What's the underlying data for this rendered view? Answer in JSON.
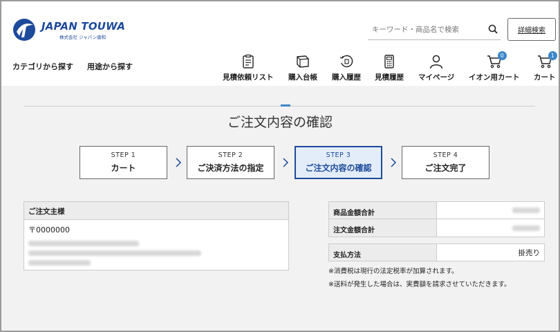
{
  "brand": {
    "name_en": "JAPAN TOUWA",
    "name_jp": "株式会社 ジャパン唐和"
  },
  "search": {
    "placeholder": "キーワード・商品名で検索",
    "advanced_label": "詳細検索"
  },
  "category_links": [
    "カテゴリから探す",
    "用途から探す"
  ],
  "nav": [
    {
      "label": "見積依頼リスト",
      "icon": "clipboard-icon"
    },
    {
      "label": "購入台帳",
      "icon": "ledger-book-icon"
    },
    {
      "label": "購入履歴",
      "icon": "history-icon"
    },
    {
      "label": "見積履歴",
      "icon": "calculator-icon"
    },
    {
      "label": "マイページ",
      "icon": "user-icon"
    },
    {
      "label": "イオン用カート",
      "icon": "cart-icon",
      "badge": "0"
    },
    {
      "label": "カート",
      "icon": "cart-icon",
      "badge": "1"
    }
  ],
  "page_title": "ご注文内容の確認",
  "steps": [
    {
      "num": "STEP 1",
      "name": "カート",
      "active": false
    },
    {
      "num": "STEP 2",
      "name": "ご決済方法の指定",
      "active": false
    },
    {
      "num": "STEP 3",
      "name": "ご注文内容の確認",
      "active": true
    },
    {
      "num": "STEP 4",
      "name": "ご注文完了",
      "active": false
    }
  ],
  "buyer": {
    "heading": "ご注文主様",
    "zip": "〒0000000"
  },
  "summary": {
    "product_total_label": "商品金額合計",
    "order_total_label": "注文金額合計",
    "payment_label": "支払方法",
    "payment_value": "掛売り"
  },
  "notes": [
    "※消費税は現行の法定税率が加算されます。",
    "※送料が発生した場合は、実費額を請求させていただきます。"
  ],
  "colors": {
    "brand_blue": "#1d4a9a",
    "accent_blue": "#3b86c8",
    "active_step_bg": "#e3edf9"
  }
}
